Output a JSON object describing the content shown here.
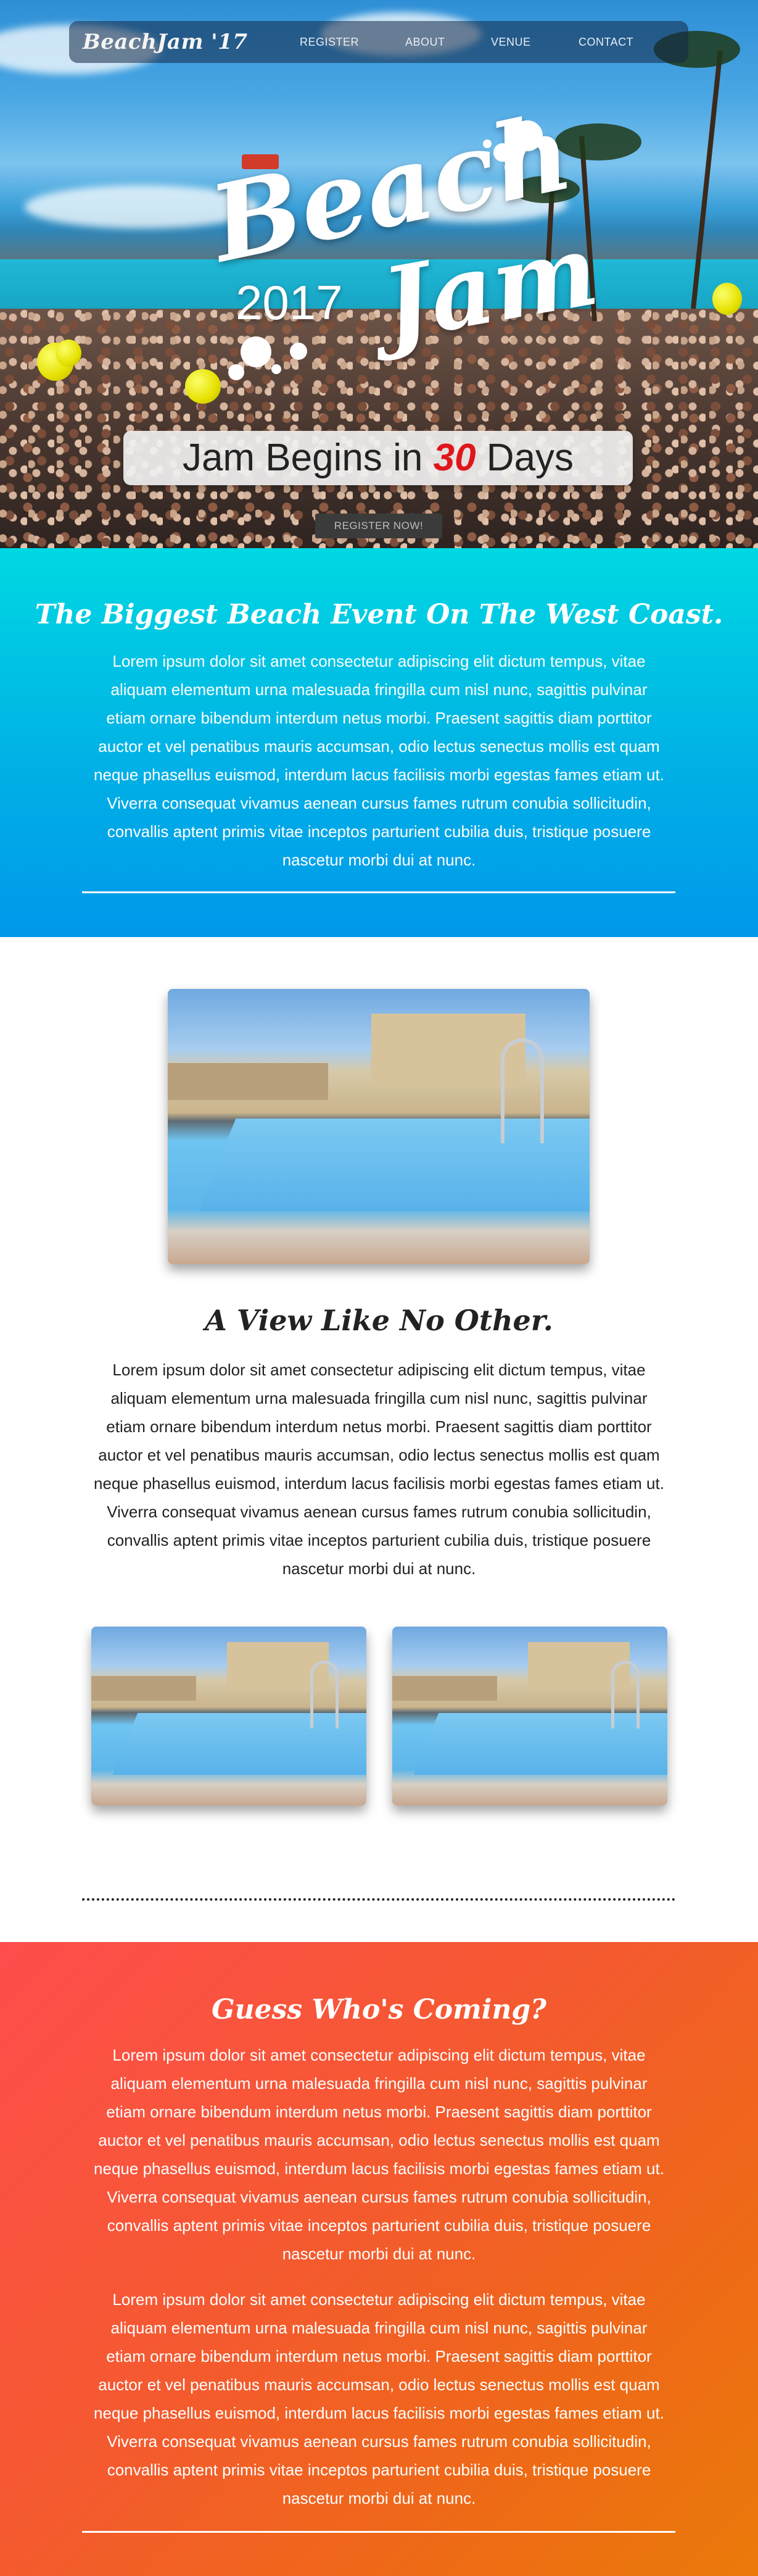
{
  "nav": {
    "brand": "BeachJam '17",
    "links": [
      "REGISTER",
      "ABOUT",
      "VENUE",
      "CONTACT"
    ]
  },
  "hero": {
    "logo_word_1": "Beach",
    "logo_word_2": "Jam",
    "year": "2017",
    "countdown_prefix": "Jam Begins in",
    "countdown_number": "30",
    "countdown_suffix": "Days",
    "register_button": "REGISTER NOW!"
  },
  "section_event": {
    "title": "The Biggest Beach Event On The West Coast.",
    "body": "Lorem ipsum dolor sit amet consectetur adipiscing elit dictum tempus, vitae aliquam elementum urna malesuada fringilla cum nisl nunc, sagittis pulvinar etiam ornare bibendum interdum netus morbi. Praesent sagittis diam porttitor auctor et vel penatibus mauris accumsan, odio lectus senectus mollis est quam neque phasellus euismod, interdum lacus facilisis morbi egestas fames etiam ut. Viverra consequat vivamus aenean cursus fames rutrum conubia sollicitudin, convallis aptent primis vitae inceptos parturient cubilia duis, tristique posuere nascetur morbi dui at nunc."
  },
  "section_view": {
    "title": "A View Like No Other.",
    "body": "Lorem ipsum dolor sit amet consectetur adipiscing elit dictum tempus, vitae aliquam elementum urna malesuada fringilla cum nisl nunc, sagittis pulvinar etiam ornare bibendum interdum netus morbi. Praesent sagittis diam porttitor auctor et vel penatibus mauris accumsan, odio lectus senectus mollis est quam neque phasellus euismod, interdum lacus facilisis morbi egestas fames etiam ut. Viverra consequat vivamus aenean cursus fames rutrum conubia sollicitudin, convallis aptent primis vitae inceptos parturient cubilia duis, tristique posuere nascetur morbi dui at nunc."
  },
  "section_guests": {
    "title": "Guess Who's Coming?",
    "body_1": "Lorem ipsum dolor sit amet consectetur adipiscing elit dictum tempus, vitae aliquam elementum urna malesuada fringilla cum nisl nunc, sagittis pulvinar etiam ornare bibendum interdum netus morbi. Praesent sagittis diam porttitor auctor et vel penatibus mauris accumsan, odio lectus senectus mollis est quam neque phasellus euismod, interdum lacus facilisis morbi egestas fames etiam ut. Viverra consequat vivamus aenean cursus fames rutrum conubia sollicitudin, convallis aptent primis vitae inceptos parturient cubilia duis, tristique posuere nascetur morbi dui at nunc.",
    "body_2": "Lorem ipsum dolor sit amet consectetur adipiscing elit dictum tempus, vitae aliquam elementum urna malesuada fringilla cum nisl nunc, sagittis pulvinar etiam ornare bibendum interdum netus morbi. Praesent sagittis diam porttitor auctor et vel penatibus mauris accumsan, odio lectus senectus mollis est quam neque phasellus euismod, interdum lacus facilisis morbi egestas fames etiam ut. Viverra consequat vivamus aenean cursus fames rutrum conubia sollicitudin, convallis aptent primis vitae inceptos parturient cubilia duis, tristique posuere nascetur morbi dui at nunc."
  },
  "colors": {
    "countdown_accent": "#e0161b",
    "blue_section_start": "#00d8e2",
    "blue_section_end": "#0098ea",
    "orange_section_start": "#ff4d4d",
    "orange_section_end": "#eb7a0a"
  }
}
